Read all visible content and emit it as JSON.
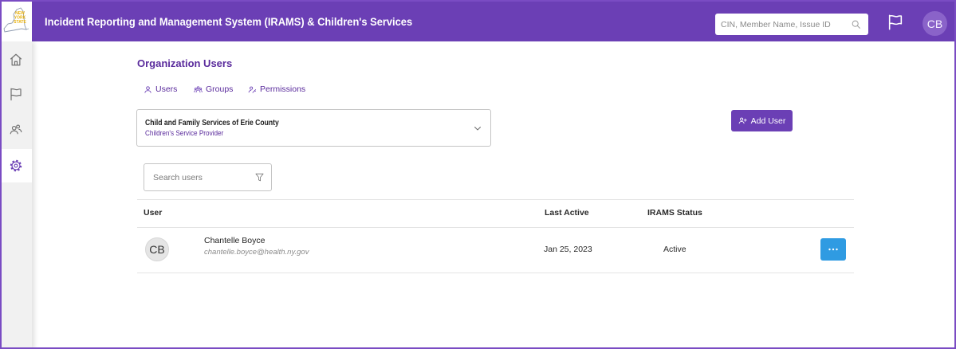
{
  "colors": {
    "brand": "#6b3fb5",
    "brand_text": "#5a2b9c",
    "action_blue": "#2f9be2",
    "header_avatar": "#8a63c9"
  },
  "logo": {
    "lines": [
      "NEW",
      "YORK",
      "STATE"
    ]
  },
  "header": {
    "title": "Incident Reporting and Management System (IRAMS) & Children's Services",
    "search": {
      "placeholder": "CIN, Member Name, Issue ID",
      "icon": "search-icon"
    },
    "flag_icon": "flag-icon",
    "avatar_initials": "CB"
  },
  "sidebar": {
    "items": [
      {
        "icon": "home-icon",
        "active": false
      },
      {
        "icon": "flag-icon",
        "active": false
      },
      {
        "icon": "users-icon",
        "active": false
      },
      {
        "icon": "gear-icon",
        "active": true
      }
    ]
  },
  "main": {
    "title": "Organization Users",
    "tabs": [
      {
        "label": "Users",
        "icon": "user-icon"
      },
      {
        "label": "Groups",
        "icon": "group-icon"
      },
      {
        "label": "Permissions",
        "icon": "permission-icon"
      }
    ],
    "organization_select": {
      "name": "Child and Family Services of Erie County",
      "type": "Children's Service Provider",
      "icon": "chevron-down-icon"
    },
    "add_user_button": {
      "label": "Add User",
      "icon": "add-user-icon"
    },
    "user_search": {
      "placeholder": "Search users",
      "icon": "filter-icon"
    },
    "table": {
      "columns": [
        "User",
        "Last Active",
        "IRAMS Status"
      ],
      "rows": [
        {
          "initials": "CB",
          "name": "Chantelle Boyce",
          "email": "chantelle.boyce@health.ny.gov",
          "last_active": "Jan 25, 2023",
          "status": "Active",
          "actions_icon": "ellipsis-icon"
        }
      ]
    }
  }
}
